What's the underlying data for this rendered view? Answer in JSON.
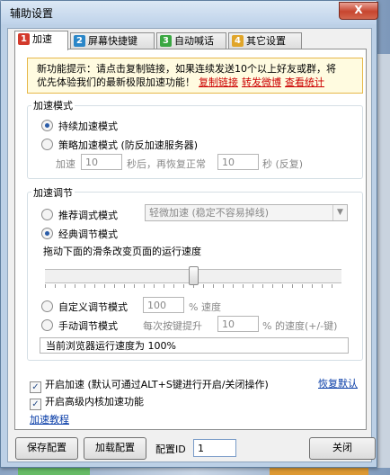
{
  "window": {
    "title": "辅助设置",
    "close_glyph": "X"
  },
  "tabs": [
    {
      "num": "1",
      "label": "加速",
      "color": "#d33a2c"
    },
    {
      "num": "2",
      "label": "屏幕快捷键",
      "color": "#2a86c8"
    },
    {
      "num": "3",
      "label": "自动喊话",
      "color": "#3aa742"
    },
    {
      "num": "4",
      "label": "其它设置",
      "color": "#e0a52a"
    }
  ],
  "notice": {
    "line1": "新功能提示：请点击复制链接，如果连续发送10个以上好友或群，将",
    "line2": "优先体验我们的最新极限加速功能！",
    "link_copy": "复制链接",
    "link_share": "转发微博",
    "link_stats": "查看统计"
  },
  "mode_group": {
    "label": "加速模式",
    "option_continuous": "持续加速模式",
    "option_strategy": "策略加速模式 (防反加速服务器)",
    "accel_label": "加速",
    "accel_value": "10",
    "restore_label": "秒后，再恢复正常",
    "restore_value": "10",
    "restore_unit": "秒  (反复)"
  },
  "adjust_group": {
    "label": "加速调节",
    "option_recommended": "推荐调式模式",
    "recommended_combo": "轻微加速 (稳定不容易掉线)",
    "option_classic": "经典调节模式",
    "slider_hint": "拖动下面的滑条改变页面的运行速度",
    "slider_position": 0.5,
    "option_custom": "自定义调节模式",
    "custom_value": "100",
    "custom_unit": "% 速度",
    "option_manual": "手动调节模式",
    "manual_label": "每次按键提升",
    "manual_value": "10",
    "manual_unit": "% 的速度(+/-键)",
    "status": "当前浏览器运行速度为 100%"
  },
  "options": {
    "enable_accel": "开启加速 (默认可通过ALT+S键进行开启/关闭操作)",
    "enable_kernel": "开启高级内核加速功能",
    "restore_default": "恢复默认",
    "tutorial": "加速教程",
    "check_glyph": "✓"
  },
  "footer": {
    "save": "保存配置",
    "load": "加载配置",
    "config_id_label": "配置ID",
    "config_id_value": "1",
    "close": "关闭"
  }
}
